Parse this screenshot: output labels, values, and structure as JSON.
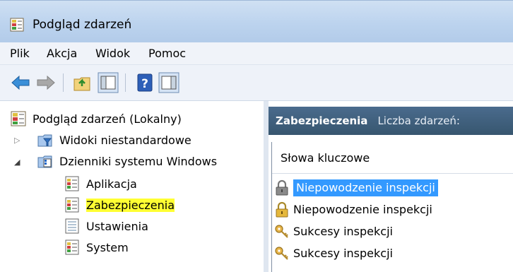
{
  "window": {
    "title": "Podgląd zdarzeń",
    "icon": "event-viewer-icon"
  },
  "menu": {
    "items": [
      "Plik",
      "Akcja",
      "Widok",
      "Pomoc"
    ]
  },
  "toolbar": {
    "buttons": [
      "back-arrow-icon",
      "forward-arrow-icon",
      "up-folder-icon",
      "show-hide-tree-icon",
      "help-icon",
      "show-hide-action-pane-icon"
    ]
  },
  "tree": {
    "root": {
      "label": "Podgląd zdarzeń (Lokalny)",
      "icon": "event-viewer-icon"
    },
    "custom_views": {
      "label": "Widoki niestandardowe",
      "icon": "filter-folder-icon",
      "expanded": false
    },
    "windows_logs": {
      "label": "Dzienniki systemu Windows",
      "icon": "log-folder-icon",
      "expanded": true
    },
    "logs": [
      {
        "label": "Aplikacja",
        "icon": "log-icon"
      },
      {
        "label": "Zabezpieczenia",
        "icon": "log-icon",
        "selected": true
      },
      {
        "label": "Ustawienia",
        "icon": "log-icon"
      },
      {
        "label": "System",
        "icon": "log-icon"
      }
    ],
    "highlight_color": "#ffff33"
  },
  "main": {
    "header_title": "Zabezpieczenia",
    "header_count_label": "Liczba zdarzeń:",
    "column_keywords": "Słowa kluczowe",
    "rows": [
      {
        "keyword": "Niepowodzenie inspekcji",
        "icon": "lock-icon",
        "selected": true
      },
      {
        "keyword": "Niepowodzenie inspekcji",
        "icon": "lock-icon",
        "selected": false
      },
      {
        "keyword": "Sukcesy inspekcji",
        "icon": "key-icon",
        "selected": false
      },
      {
        "keyword": "Sukcesy inspekcji",
        "icon": "key-icon",
        "selected": false
      }
    ],
    "selection_color": "#3399ff",
    "header_color": "#3e5f7f"
  }
}
